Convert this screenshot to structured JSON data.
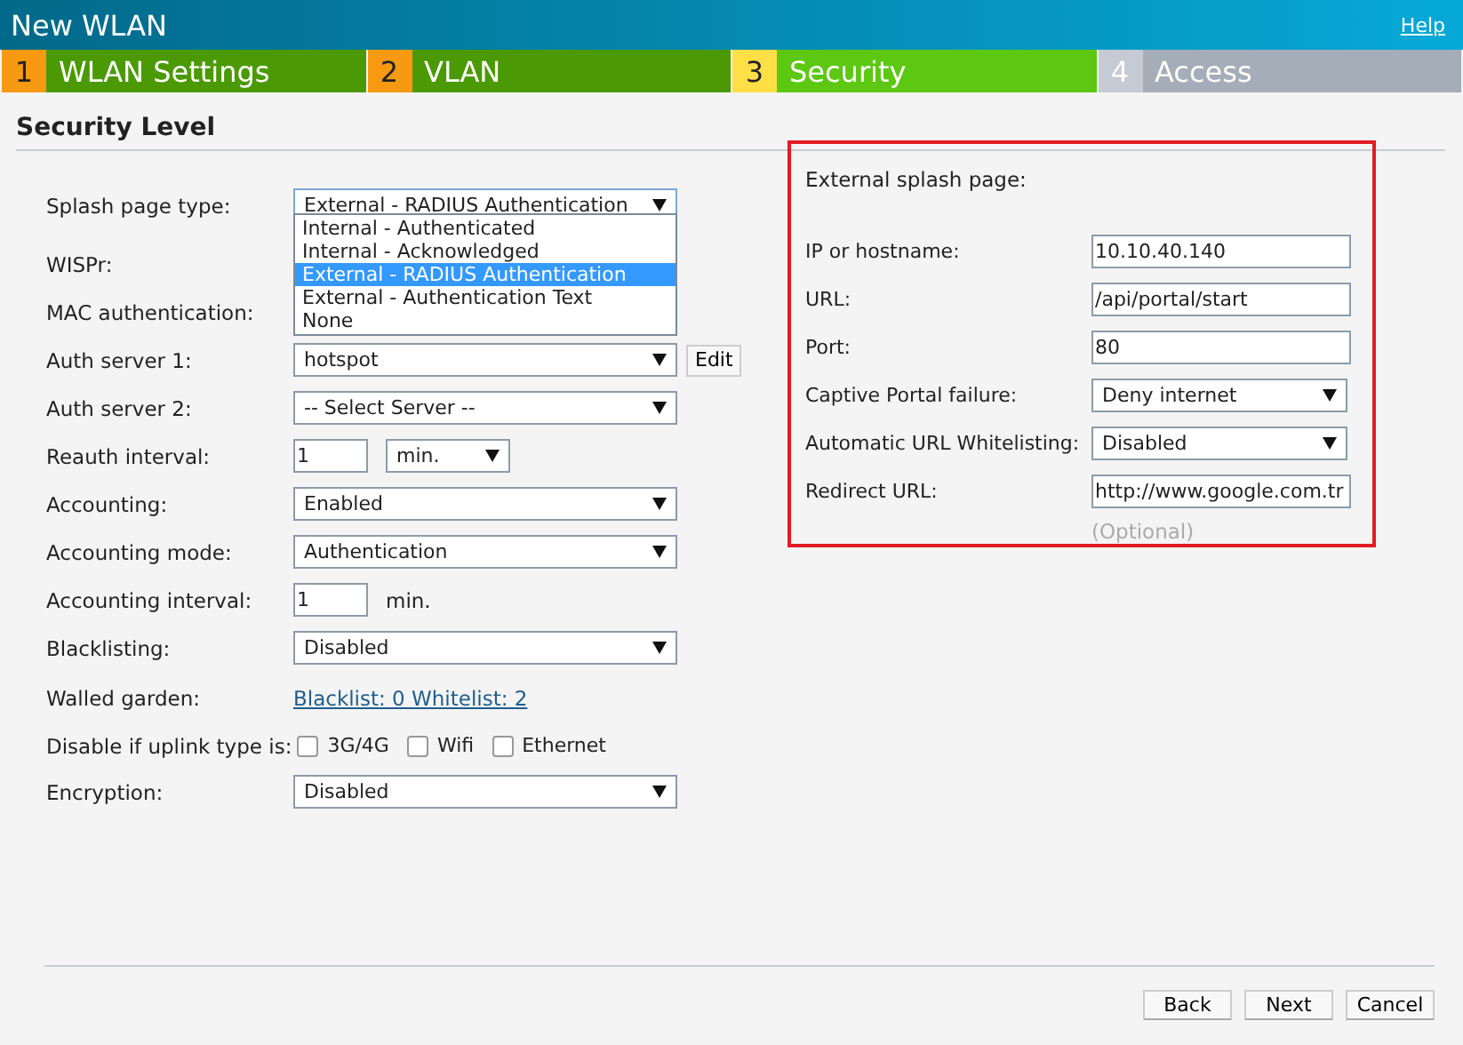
{
  "window": {
    "title": "New WLAN",
    "help": "Help"
  },
  "steps": [
    {
      "number": "1",
      "label": "WLAN Settings",
      "kind": "done"
    },
    {
      "number": "2",
      "label": "VLAN",
      "kind": "done"
    },
    {
      "number": "3",
      "label": "Security",
      "kind": "current"
    },
    {
      "number": "4",
      "label": "Access",
      "kind": "todo"
    }
  ],
  "section_title": "Security Level",
  "form": [
    {
      "kind": "select",
      "label": "Splash page type:",
      "value": "External - RADIUS Authentication",
      "focused": true
    },
    {
      "kind": "blank",
      "label": "WISPr:"
    },
    {
      "kind": "blank",
      "label": "MAC authentication:"
    },
    {
      "kind": "select_edit",
      "label": "Auth server 1:",
      "value": "hotspot",
      "button": "Edit"
    },
    {
      "kind": "select",
      "label": "Auth server 2:",
      "value": "-- Select Server --",
      "focused": false
    },
    {
      "kind": "number_select",
      "label": "Reauth interval:",
      "value": "1",
      "unit": "min."
    },
    {
      "kind": "select",
      "label": "Accounting:",
      "value": "Enabled",
      "focused": false
    },
    {
      "kind": "select",
      "label": "Accounting mode:",
      "value": "Authentication",
      "focused": false
    },
    {
      "kind": "number_unit",
      "label": "Accounting interval:",
      "value": "1",
      "unit": "min."
    },
    {
      "kind": "select",
      "label": "Blacklisting:",
      "value": "Disabled",
      "focused": false
    },
    {
      "kind": "link",
      "label": "Walled garden:",
      "value": "Blacklist: 0 Whitelist: 2"
    },
    {
      "kind": "checkboxes",
      "label": "Disable if uplink type is:",
      "options": [
        {
          "label": "3G/4G",
          "checked": false
        },
        {
          "label": "Wifi",
          "checked": false
        },
        {
          "label": "Ethernet",
          "checked": false
        }
      ]
    },
    {
      "kind": "select",
      "label": "Encryption:",
      "value": "Disabled",
      "focused": false
    }
  ],
  "dropdown_options": [
    {
      "label": "Internal - Authenticated",
      "selected": false
    },
    {
      "label": "Internal - Acknowledged",
      "selected": false
    },
    {
      "label": "External - RADIUS Authentication",
      "selected": true
    },
    {
      "label": "External - Authentication Text",
      "selected": false
    },
    {
      "label": "None",
      "selected": false
    }
  ],
  "external": {
    "heading": "External splash page:",
    "rows": [
      {
        "kind": "input",
        "label": "IP or hostname:",
        "value": "10.10.40.140"
      },
      {
        "kind": "input",
        "label": "URL:",
        "value": "/api/portal/start"
      },
      {
        "kind": "input",
        "label": "Port:",
        "value": "80"
      },
      {
        "kind": "select",
        "label": "Captive Portal failure:",
        "value": "Deny internet"
      },
      {
        "kind": "select",
        "label": "Automatic URL Whitelisting:",
        "value": "Disabled"
      },
      {
        "kind": "input",
        "label": "Redirect URL:",
        "value": "http://www.google.com.tr"
      }
    ],
    "note": "(Optional)"
  },
  "buttons": [
    "Back",
    "Next",
    "Cancel"
  ]
}
